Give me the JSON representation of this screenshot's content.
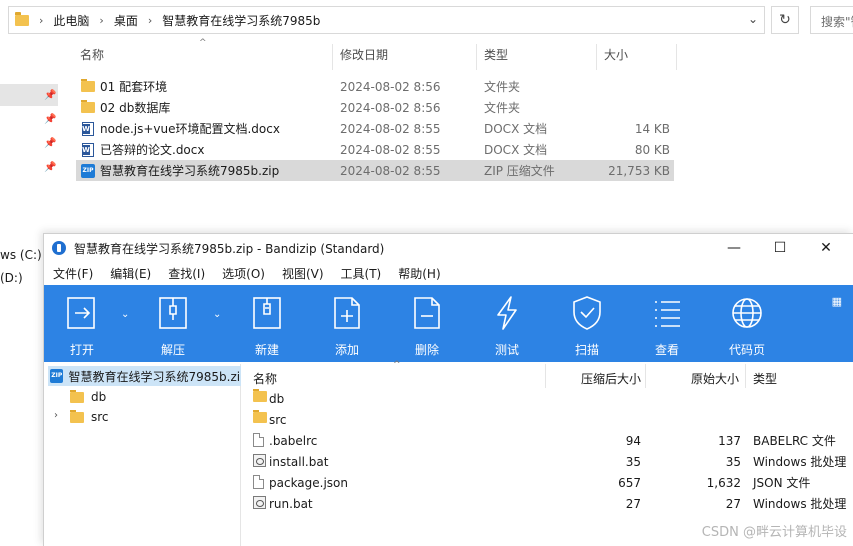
{
  "explorer": {
    "breadcrumb": [
      "此电脑",
      "桌面",
      "智慧教育在线学习系统7985b"
    ],
    "search_placeholder": "搜索\"智",
    "columns": {
      "name": "名称",
      "date": "修改日期",
      "type": "类型",
      "size": "大小"
    },
    "nav_drives": [
      "ws (C:)",
      "(D:)"
    ],
    "files": [
      {
        "name": "01  配套环境",
        "date": "2024-08-02 8:56",
        "type": "文件夹",
        "size": "",
        "icon": "folder-icon"
      },
      {
        "name": "02 db数据库",
        "date": "2024-08-02 8:56",
        "type": "文件夹",
        "size": "",
        "icon": "folder-icon"
      },
      {
        "name": "node.js+vue环境配置文档.docx",
        "date": "2024-08-02 8:55",
        "type": "DOCX 文档",
        "size": "14 KB",
        "icon": "docx-icon"
      },
      {
        "name": "已答辩的论文.docx",
        "date": "2024-08-02 8:55",
        "type": "DOCX 文档",
        "size": "80 KB",
        "icon": "docx-icon"
      },
      {
        "name": "智慧教育在线学习系统7985b.zip",
        "date": "2024-08-02 8:55",
        "type": "ZIP 压缩文件",
        "size": "21,753 KB",
        "icon": "zip-icon",
        "selected": true
      }
    ]
  },
  "bandizip": {
    "title": "智慧教育在线学习系统7985b.zip - Bandizip (Standard)",
    "window_buttons": {
      "minimize": "—",
      "maximize": "☐",
      "close": "✕"
    },
    "menu": [
      "文件(F)",
      "编辑(E)",
      "查找(I)",
      "选项(O)",
      "视图(V)",
      "工具(T)",
      "帮助(H)"
    ],
    "toolbar": [
      {
        "label": "打开",
        "icon": "open-icon",
        "dropdown": true
      },
      {
        "label": "解压",
        "icon": "extract-icon",
        "dropdown": true
      },
      {
        "label": "新建",
        "icon": "new-archive-icon"
      },
      {
        "label": "添加",
        "icon": "add-file-icon"
      },
      {
        "label": "删除",
        "icon": "delete-file-icon"
      },
      {
        "label": "测试",
        "icon": "test-bolt-icon"
      },
      {
        "label": "扫描",
        "icon": "scan-shield-icon"
      },
      {
        "label": "查看",
        "icon": "view-list-icon"
      },
      {
        "label": "代码页",
        "icon": "codepage-globe-icon"
      }
    ],
    "tree": {
      "root": "智慧教育在线学习系统7985b.zip",
      "children": [
        {
          "name": "db",
          "expandable": false
        },
        {
          "name": "src",
          "expandable": true
        }
      ]
    },
    "list_columns": {
      "name": "名称",
      "compressed": "压缩后大小",
      "original": "原始大小",
      "type": "类型"
    },
    "entries": [
      {
        "name": "db",
        "compressed": "",
        "original": "",
        "type": "",
        "icon": "folder-icon"
      },
      {
        "name": "src",
        "compressed": "",
        "original": "",
        "type": "",
        "icon": "folder-icon"
      },
      {
        "name": ".babelrc",
        "compressed": "94",
        "original": "137",
        "type": "BABELRC 文件",
        "icon": "file-icon"
      },
      {
        "name": "install.bat",
        "compressed": "35",
        "original": "35",
        "type": "Windows 批处理",
        "icon": "bat-icon"
      },
      {
        "name": "package.json",
        "compressed": "657",
        "original": "1,632",
        "type": "JSON 文件",
        "icon": "file-icon"
      },
      {
        "name": "run.bat",
        "compressed": "27",
        "original": "27",
        "type": "Windows 批处理",
        "icon": "bat-icon"
      }
    ]
  },
  "watermark": "CSDN @畔云计算机毕设"
}
